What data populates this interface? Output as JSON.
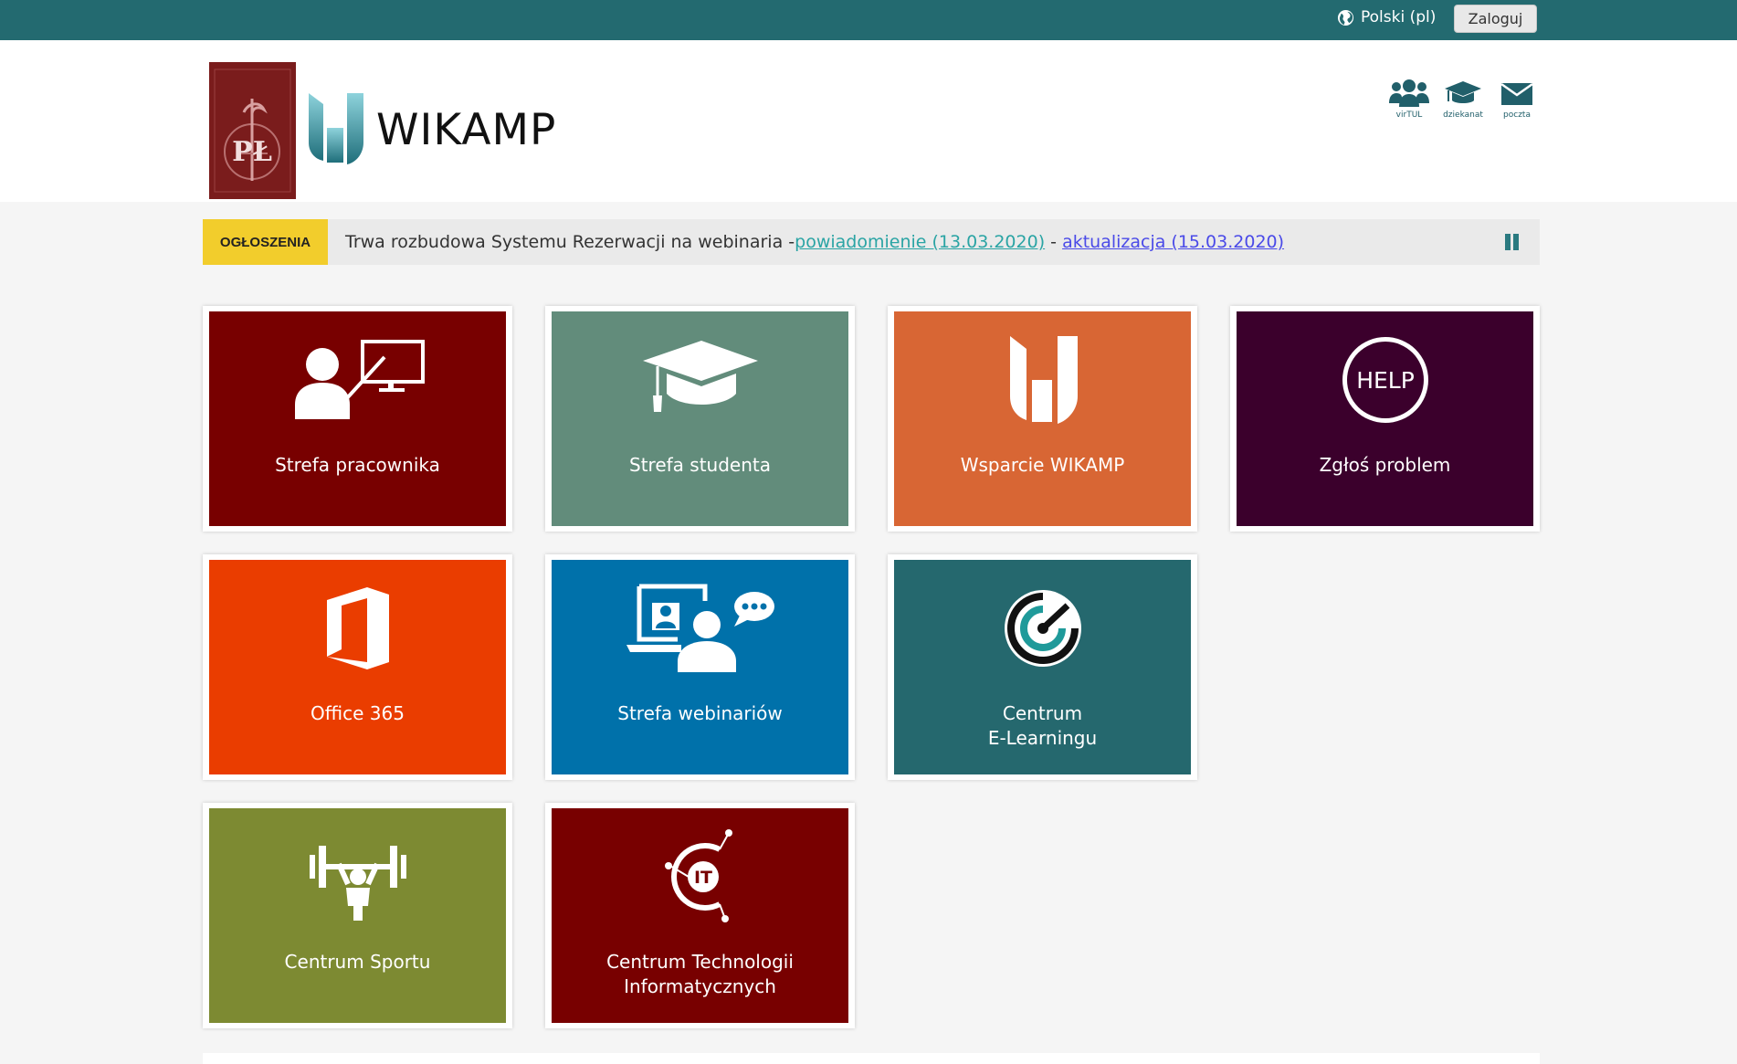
{
  "topbar": {
    "language": "Polski (pl)",
    "login_label": "Zaloguj"
  },
  "header": {
    "brand": "WIKAMP",
    "university_logo_text": "PŁ",
    "quick_links": [
      {
        "label": "virTUL",
        "icon": "users-icon"
      },
      {
        "label": "dziekanat",
        "icon": "graduation-cap-icon"
      },
      {
        "label": "poczta",
        "icon": "envelope-icon"
      }
    ]
  },
  "announcement": {
    "tag": "OGŁOSZENIA",
    "text": "Trwa rozbudowa Systemu Rezerwacji na webinaria - ",
    "link1": "powiadomienie (13.03.2020)",
    "separator": " - ",
    "link2": "aktualizacja (15.03.2020)"
  },
  "tiles": [
    {
      "label": "Strefa pracownika",
      "color": "#780000",
      "icon": "teacher-icon"
    },
    {
      "label": "Strefa studenta",
      "color": "#628c7b",
      "icon": "graduation-cap-icon"
    },
    {
      "label": "Wsparcie WIKAMP",
      "color": "#d86634",
      "icon": "wikamp-logo-icon"
    },
    {
      "label": "Zgłoś problem",
      "color": "#3b002c",
      "icon": "help-icon",
      "icon_text": "HELP"
    },
    {
      "label": "Office 365",
      "color": "#ea3d00",
      "icon": "office-icon"
    },
    {
      "label": "Strefa webinariów",
      "color": "#0071aa",
      "icon": "webinar-icon"
    },
    {
      "label_line1": "Centrum",
      "label_line2": "E-Learningu",
      "color": "#25686e",
      "icon": "elearning-icon"
    },
    {
      "label": "Centrum Sportu",
      "color": "#7d8a32",
      "icon": "weightlifting-icon"
    },
    {
      "label_line1": "Centrum Technologii",
      "label_line2": "Informatycznych",
      "color": "#780000",
      "icon": "it-center-icon",
      "icon_text": "IT"
    }
  ]
}
